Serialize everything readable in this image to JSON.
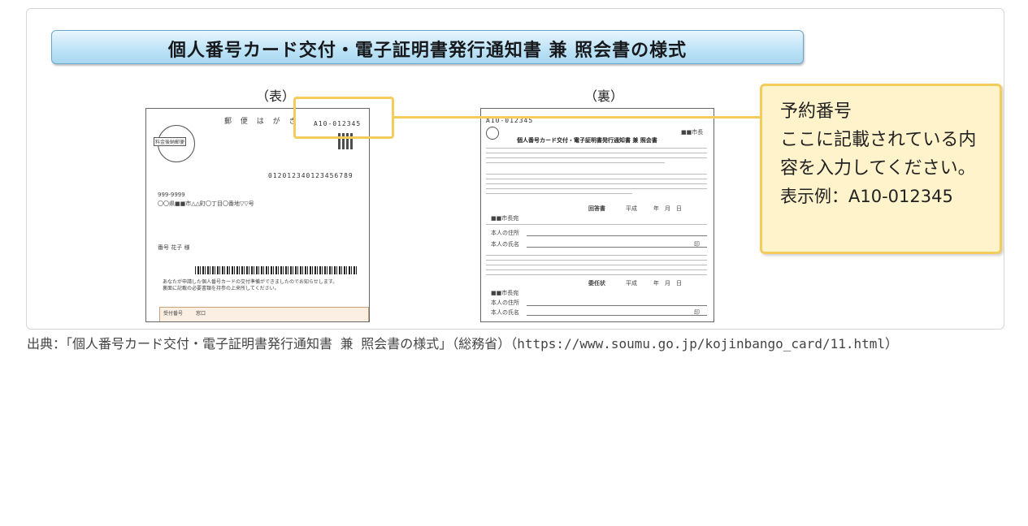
{
  "figure": {
    "title": "個人番号カード交付・電子証明書発行通知書 兼 照会書の様式",
    "front_label": "（表）",
    "back_label": "（裏）",
    "front_card": {
      "postcard_header": "郵 便 は が き",
      "reservation_no": "A10-012345",
      "stamp_text": "料金後納郵便",
      "id_digits": "012012340123456789",
      "postcode": "999-9999",
      "address": "〇〇県■■市△△町〇丁目〇番地▽▽号",
      "recipient": "番号 花子 様",
      "notice_line1": "あなたが申請した個人番号カードの交付準備ができましたのでお知らせします。",
      "notice_line2": "裏面に記載の必要書類を持参の上来所してください。",
      "bottom_label1": "受付番号",
      "bottom_label2": "窓口"
    },
    "back_card": {
      "reservation_no": "A10-012345",
      "mayor": "■■市長",
      "heading": "個人番号カード交付・電子証明書発行通知書 兼 照会書",
      "section_reply": "回答書",
      "era": "平成",
      "date_units": "年　月　日",
      "to_mayor": "■■市長宛",
      "address_label": "本人の住所",
      "name_label": "本人の氏名",
      "seal": "印",
      "section_delegation": "委任状"
    },
    "callout": {
      "line1": "予約番号",
      "line2": "ここに記載されている内容を入力してください。",
      "example": "表示例：A10-012345"
    }
  },
  "source": "出典：「個人番号カード交付・電子証明書発行通知書 兼 照会書の様式」（総務省）（https://www.soumu.go.jp/kojinbango_card/11.html）",
  "colors": {
    "highlight": "#f4cc5b",
    "callout_bg": "#fff3cc",
    "title_bar": "#bfe4f7"
  }
}
